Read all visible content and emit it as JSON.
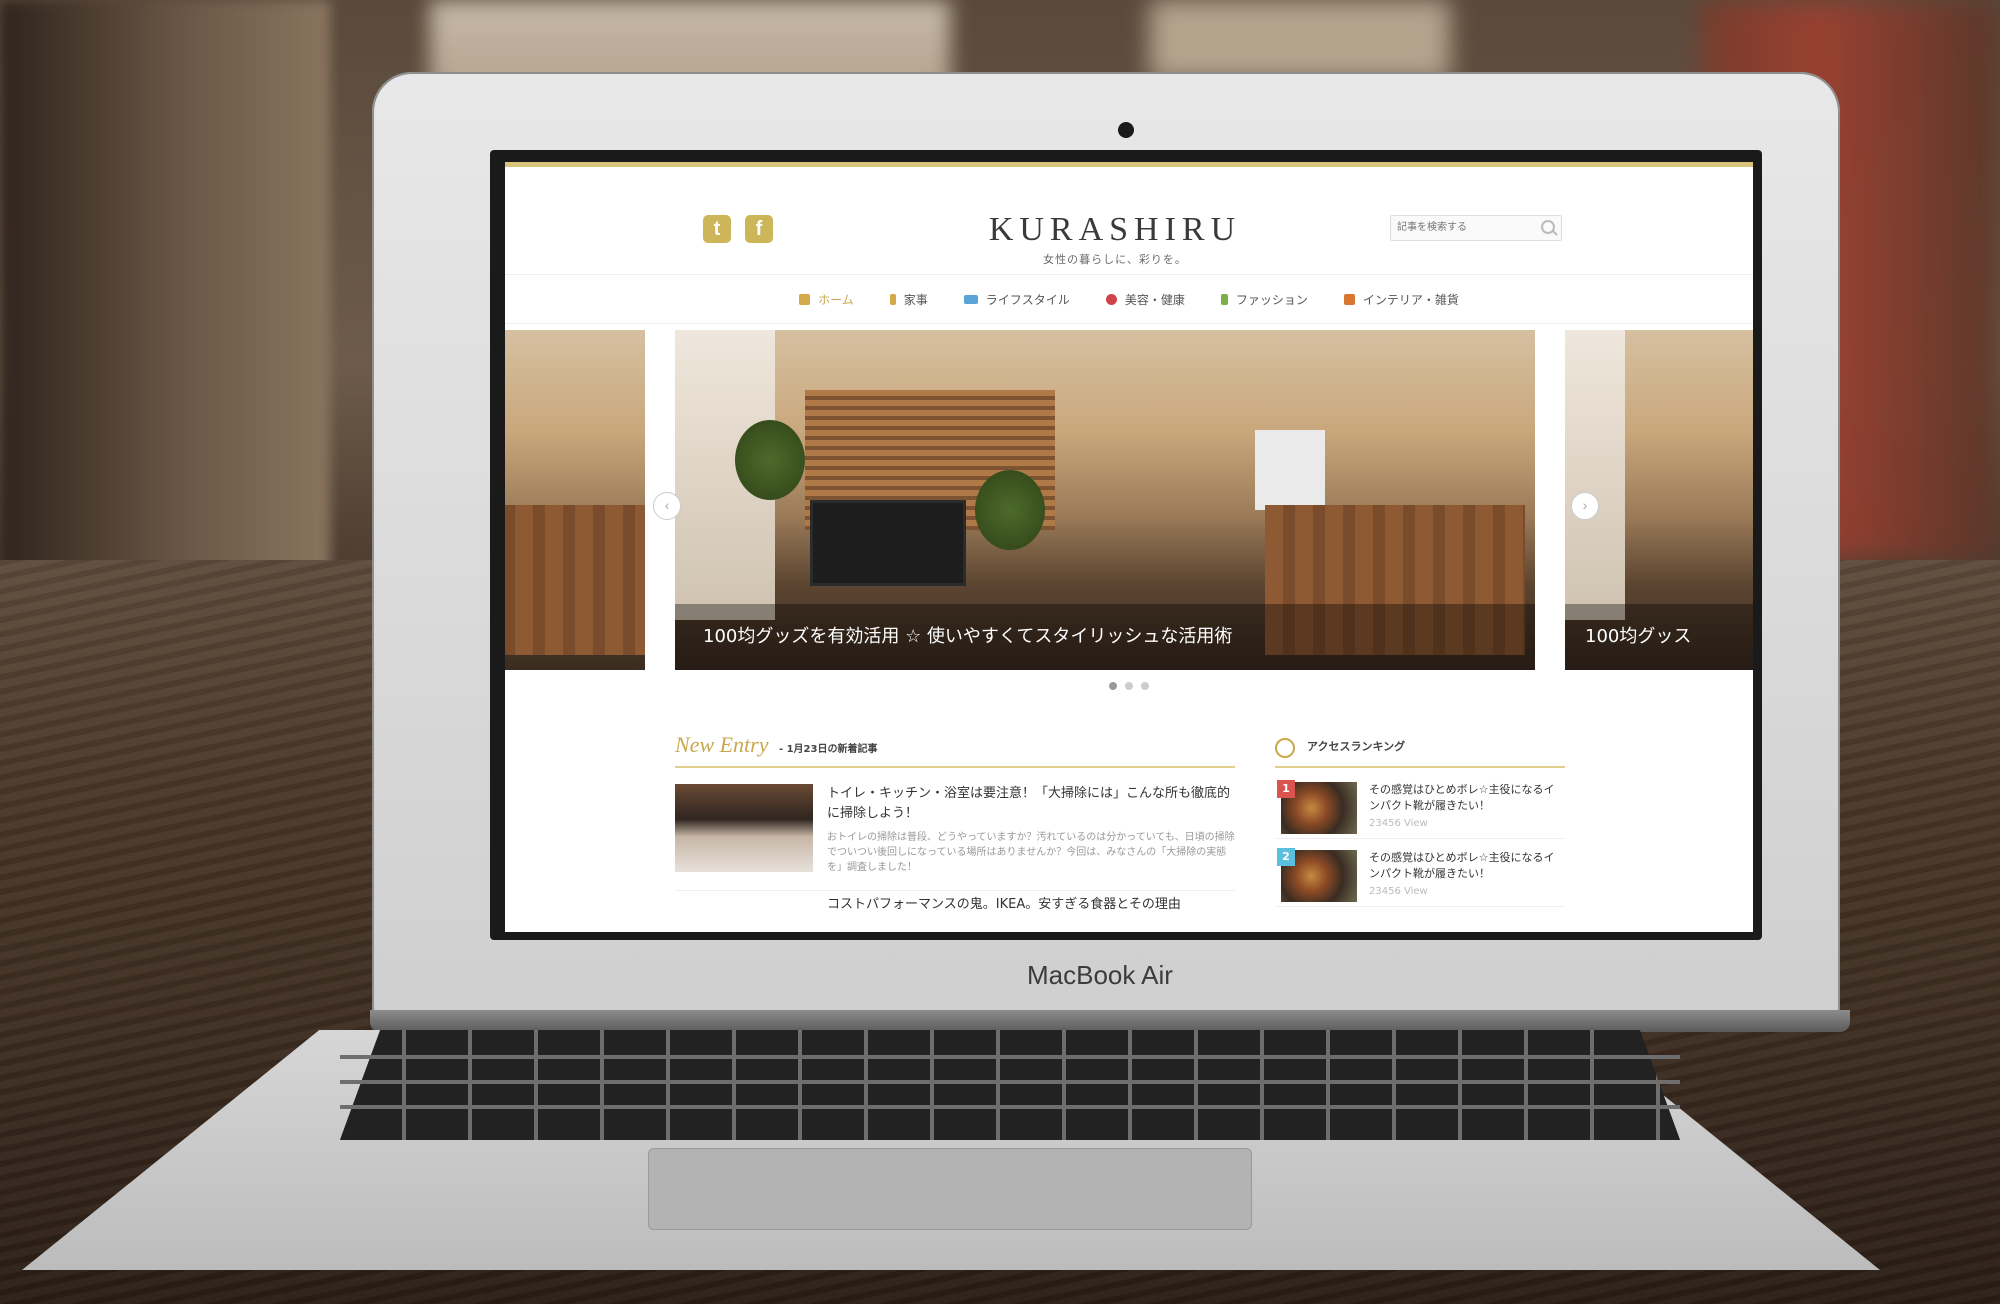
{
  "device": {
    "brand_label": "MacBook Air"
  },
  "site": {
    "logo": "KURASHIRU",
    "tagline": "女性の暮らしに、彩りを。",
    "social": [
      {
        "name": "twitter",
        "glyph": "t"
      },
      {
        "name": "facebook",
        "glyph": "f"
      }
    ],
    "search_placeholder": "記事を検索する",
    "accent_color": "#c9a84d"
  },
  "nav": [
    {
      "label": "ホーム",
      "icon": "home-icon",
      "color": "#d3a94a",
      "active": true
    },
    {
      "label": "家事",
      "icon": "utensils-icon",
      "color": "#d3a94a",
      "active": false
    },
    {
      "label": "ライフスタイル",
      "icon": "laptop-icon",
      "color": "#5aa3d6",
      "active": false
    },
    {
      "label": "美容・健康",
      "icon": "heart-icon",
      "color": "#d0434a",
      "active": false
    },
    {
      "label": "ファッション",
      "icon": "person-icon",
      "color": "#7ab04a",
      "active": false
    },
    {
      "label": "インテリア・雑貨",
      "icon": "cup-icon",
      "color": "#d9772f",
      "active": false
    }
  ],
  "slider": {
    "main_caption": "100均グッズを有効活用 ☆ 使いやすくてスタイリッシュな活用術",
    "side_caption": "100均グッス",
    "prev": "‹",
    "next": "›",
    "dots": 3,
    "active_dot": 0
  },
  "new_entry": {
    "heading": "New Entry",
    "subheading": "- 1月23日の新着記事",
    "articles": [
      {
        "title": "トイレ・キッチン・浴室は要注意！「大掃除には」こんな所も徹底的に掃除しよう！",
        "description": "おトイレの掃除は普段、どうやっていますか？汚れているのは分かっていても、日頃の掃除でついつい後回しになっている場所はありませんか？今回は、みなさんの「大掃除の実態を」調査しました！"
      },
      {
        "title": "コストパフォーマンスの鬼。IKEA。安すぎる食器とその理由",
        "description": ""
      }
    ]
  },
  "ranking": {
    "heading": "アクセスランキング",
    "items": [
      {
        "rank": "1",
        "badge_color": "#d9534f",
        "title": "その感覚はひとめボレ☆主役になるインパクト靴が履きたい！",
        "views": "23456 View"
      },
      {
        "rank": "2",
        "badge_color": "#5bc0de",
        "title": "その感覚はひとめボレ☆主役になるインパクト靴が履きたい！",
        "views": "23456 View"
      }
    ]
  }
}
